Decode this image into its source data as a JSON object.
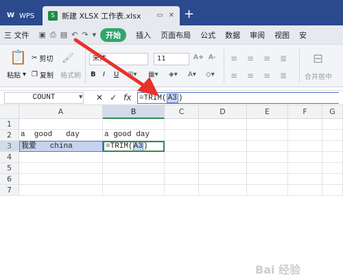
{
  "titlebar": {
    "app_label": "WPS",
    "doc_tab": "新建 XLSX 工作表.xlsx",
    "new_tab": "+"
  },
  "menubar": {
    "file": "三 文件",
    "items": [
      "开始",
      "插入",
      "页面布局",
      "公式",
      "数据",
      "审阅",
      "视图",
      "安"
    ]
  },
  "ribbon": {
    "paste": "粘贴",
    "cut": "剪切",
    "copy": "复制",
    "format_painter": "格式刷",
    "font_name": "宋体",
    "font_size": "11",
    "bold": "B",
    "italic": "I",
    "underline": "U",
    "grow": "A+",
    "shrink": "A-",
    "merge": "合并居中"
  },
  "formulabar": {
    "name_box": "COUNT",
    "cancel": "✕",
    "accept": "✓",
    "fx": "fx",
    "formula_prefix": "=TRIM(",
    "formula_ref": "A3",
    "formula_suffix": ")"
  },
  "grid": {
    "columns": [
      "A",
      "B",
      "C",
      "D",
      "E",
      "F",
      "G"
    ],
    "rows": [
      "1",
      "2",
      "3",
      "4",
      "5",
      "6",
      "7"
    ],
    "a2": "a  good   day",
    "b2": "a good day",
    "a3": "我爱   china",
    "b3_prefix": "=TRIM(",
    "b3_ref": "A3",
    "b3_suffix": ")"
  },
  "watermark": "Bai 经验",
  "colors": {
    "titlebar": "#2b4a8e",
    "start_green": "#33a56c",
    "arrow_red": "#e8322a",
    "active_cell": "#2f8a4f"
  }
}
